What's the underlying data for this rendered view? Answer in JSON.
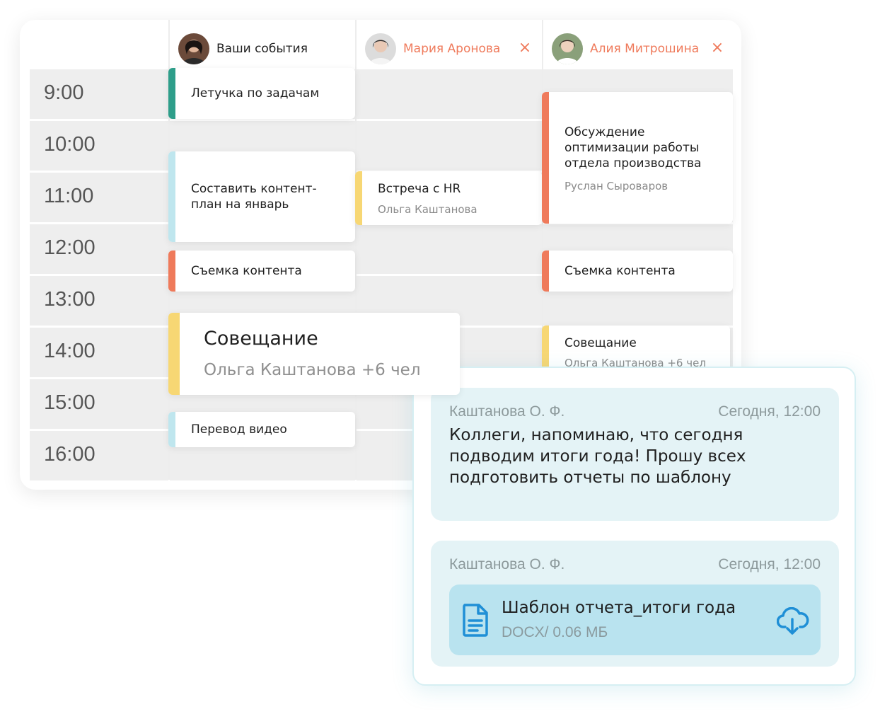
{
  "calendar": {
    "columns": [
      {
        "name": "Ваши события",
        "closable": false
      },
      {
        "name": "Мария Аронова",
        "closable": true
      },
      {
        "name": "Алия Митрошина",
        "closable": true
      }
    ],
    "close_glyph": "×",
    "times": [
      "9:00",
      "10:00",
      "11:00",
      "12:00",
      "13:00",
      "14:00",
      "15:00",
      "16:00"
    ],
    "events": {
      "e1": {
        "title": "Летучка по задачам",
        "color": "#2e9e8a"
      },
      "e2": {
        "title": "Составить контент-план на январь",
        "color": "#bfe6ee"
      },
      "e3": {
        "title": "Съемка контента",
        "color": "#ef7a5b"
      },
      "e4": {
        "title": "Совещание",
        "subtitle": "Ольга Каштанова +6 чел",
        "color": "#f7d774"
      },
      "e5": {
        "title": "Перевод видео",
        "color": "#bfe6ee"
      },
      "e6": {
        "title": "Встреча с HR",
        "subtitle": "Ольга Каштанова",
        "color": "#f7d774"
      },
      "e7": {
        "title": "Обсуждение оптимизации работы отдела производства",
        "subtitle": "Руслан Сыроваров",
        "color": "#ef7a5b"
      },
      "e8": {
        "title": "Съемка контента",
        "color": "#ef7a5b"
      },
      "e9": {
        "title": "Совещание",
        "subtitle": "Ольга Каштанова +6 чел",
        "color": "#f7d774"
      }
    }
  },
  "chat": {
    "messages": [
      {
        "author": "Каштанова О. Ф.",
        "time": "Сегодня, 12:00",
        "text": "Коллеги, напоминаю, что сегодня подводим итоги года! Прошу всех подготовить отчеты по шаблону"
      },
      {
        "author": "Каштанова О. Ф.",
        "time": "Сегодня, 12:00",
        "file": {
          "name": "Шаблон отчета_итоги года",
          "meta": "DOCX/ 0.06 МБ",
          "icon": "document-icon",
          "action_icon": "cloud-download-icon"
        }
      }
    ],
    "accent": "#1f8fd6"
  }
}
